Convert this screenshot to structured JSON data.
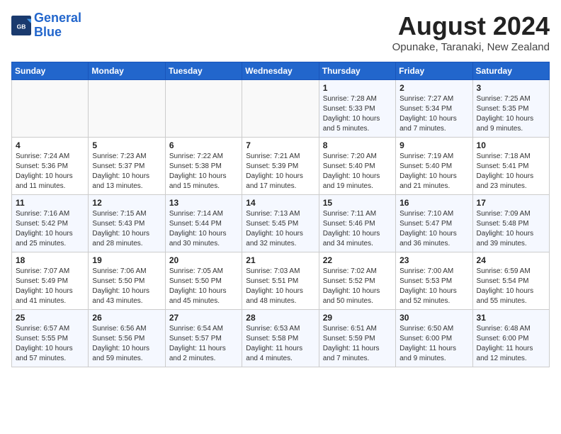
{
  "header": {
    "logo_line1": "General",
    "logo_line2": "Blue",
    "main_title": "August 2024",
    "subtitle": "Opunake, Taranaki, New Zealand"
  },
  "weekdays": [
    "Sunday",
    "Monday",
    "Tuesday",
    "Wednesday",
    "Thursday",
    "Friday",
    "Saturday"
  ],
  "weeks": [
    [
      {
        "day": "",
        "info": ""
      },
      {
        "day": "",
        "info": ""
      },
      {
        "day": "",
        "info": ""
      },
      {
        "day": "",
        "info": ""
      },
      {
        "day": "1",
        "info": "Sunrise: 7:28 AM\nSunset: 5:33 PM\nDaylight: 10 hours\nand 5 minutes."
      },
      {
        "day": "2",
        "info": "Sunrise: 7:27 AM\nSunset: 5:34 PM\nDaylight: 10 hours\nand 7 minutes."
      },
      {
        "day": "3",
        "info": "Sunrise: 7:25 AM\nSunset: 5:35 PM\nDaylight: 10 hours\nand 9 minutes."
      }
    ],
    [
      {
        "day": "4",
        "info": "Sunrise: 7:24 AM\nSunset: 5:36 PM\nDaylight: 10 hours\nand 11 minutes."
      },
      {
        "day": "5",
        "info": "Sunrise: 7:23 AM\nSunset: 5:37 PM\nDaylight: 10 hours\nand 13 minutes."
      },
      {
        "day": "6",
        "info": "Sunrise: 7:22 AM\nSunset: 5:38 PM\nDaylight: 10 hours\nand 15 minutes."
      },
      {
        "day": "7",
        "info": "Sunrise: 7:21 AM\nSunset: 5:39 PM\nDaylight: 10 hours\nand 17 minutes."
      },
      {
        "day": "8",
        "info": "Sunrise: 7:20 AM\nSunset: 5:40 PM\nDaylight: 10 hours\nand 19 minutes."
      },
      {
        "day": "9",
        "info": "Sunrise: 7:19 AM\nSunset: 5:40 PM\nDaylight: 10 hours\nand 21 minutes."
      },
      {
        "day": "10",
        "info": "Sunrise: 7:18 AM\nSunset: 5:41 PM\nDaylight: 10 hours\nand 23 minutes."
      }
    ],
    [
      {
        "day": "11",
        "info": "Sunrise: 7:16 AM\nSunset: 5:42 PM\nDaylight: 10 hours\nand 25 minutes."
      },
      {
        "day": "12",
        "info": "Sunrise: 7:15 AM\nSunset: 5:43 PM\nDaylight: 10 hours\nand 28 minutes."
      },
      {
        "day": "13",
        "info": "Sunrise: 7:14 AM\nSunset: 5:44 PM\nDaylight: 10 hours\nand 30 minutes."
      },
      {
        "day": "14",
        "info": "Sunrise: 7:13 AM\nSunset: 5:45 PM\nDaylight: 10 hours\nand 32 minutes."
      },
      {
        "day": "15",
        "info": "Sunrise: 7:11 AM\nSunset: 5:46 PM\nDaylight: 10 hours\nand 34 minutes."
      },
      {
        "day": "16",
        "info": "Sunrise: 7:10 AM\nSunset: 5:47 PM\nDaylight: 10 hours\nand 36 minutes."
      },
      {
        "day": "17",
        "info": "Sunrise: 7:09 AM\nSunset: 5:48 PM\nDaylight: 10 hours\nand 39 minutes."
      }
    ],
    [
      {
        "day": "18",
        "info": "Sunrise: 7:07 AM\nSunset: 5:49 PM\nDaylight: 10 hours\nand 41 minutes."
      },
      {
        "day": "19",
        "info": "Sunrise: 7:06 AM\nSunset: 5:50 PM\nDaylight: 10 hours\nand 43 minutes."
      },
      {
        "day": "20",
        "info": "Sunrise: 7:05 AM\nSunset: 5:50 PM\nDaylight: 10 hours\nand 45 minutes."
      },
      {
        "day": "21",
        "info": "Sunrise: 7:03 AM\nSunset: 5:51 PM\nDaylight: 10 hours\nand 48 minutes."
      },
      {
        "day": "22",
        "info": "Sunrise: 7:02 AM\nSunset: 5:52 PM\nDaylight: 10 hours\nand 50 minutes."
      },
      {
        "day": "23",
        "info": "Sunrise: 7:00 AM\nSunset: 5:53 PM\nDaylight: 10 hours\nand 52 minutes."
      },
      {
        "day": "24",
        "info": "Sunrise: 6:59 AM\nSunset: 5:54 PM\nDaylight: 10 hours\nand 55 minutes."
      }
    ],
    [
      {
        "day": "25",
        "info": "Sunrise: 6:57 AM\nSunset: 5:55 PM\nDaylight: 10 hours\nand 57 minutes."
      },
      {
        "day": "26",
        "info": "Sunrise: 6:56 AM\nSunset: 5:56 PM\nDaylight: 10 hours\nand 59 minutes."
      },
      {
        "day": "27",
        "info": "Sunrise: 6:54 AM\nSunset: 5:57 PM\nDaylight: 11 hours\nand 2 minutes."
      },
      {
        "day": "28",
        "info": "Sunrise: 6:53 AM\nSunset: 5:58 PM\nDaylight: 11 hours\nand 4 minutes."
      },
      {
        "day": "29",
        "info": "Sunrise: 6:51 AM\nSunset: 5:59 PM\nDaylight: 11 hours\nand 7 minutes."
      },
      {
        "day": "30",
        "info": "Sunrise: 6:50 AM\nSunset: 6:00 PM\nDaylight: 11 hours\nand 9 minutes."
      },
      {
        "day": "31",
        "info": "Sunrise: 6:48 AM\nSunset: 6:00 PM\nDaylight: 11 hours\nand 12 minutes."
      }
    ]
  ]
}
